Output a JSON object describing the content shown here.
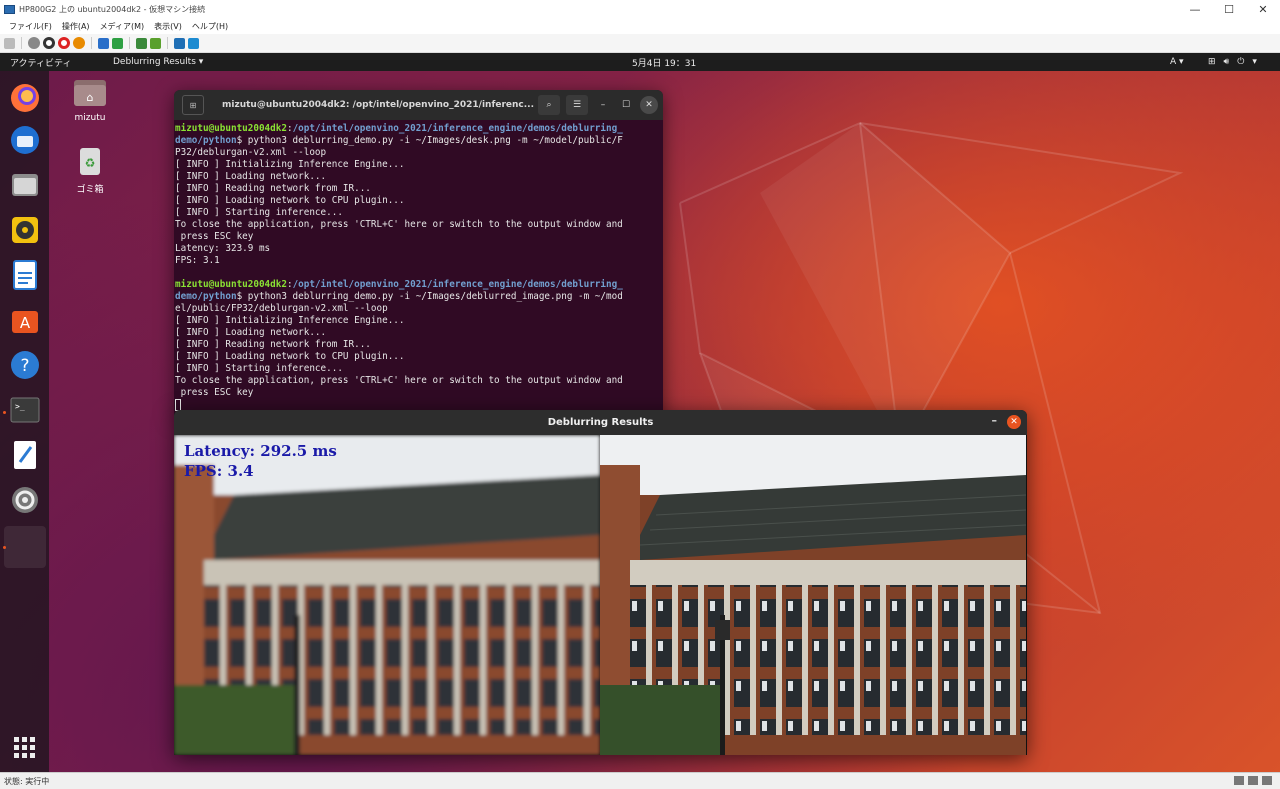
{
  "host": {
    "title": "HP800G2 上の ubuntu2004dk2 - 仮想マシン接続",
    "menu": [
      "ファイル(F)",
      "操作(A)",
      "メディア(M)",
      "表示(V)",
      "ヘルプ(H)"
    ],
    "status_text": "状態: 実行中"
  },
  "panel": {
    "activities": "アクティビティ",
    "app_menu": "Deblurring Results ▾",
    "clock": "5月4日  19：31",
    "input_method": "A ▾",
    "tray_menu": "▾"
  },
  "desktop": {
    "home_label": "mizutu",
    "trash_label": "ゴミ箱"
  },
  "terminal": {
    "title": "mizutu@ubuntu2004dk2: /opt/intel/openvino_2021/inferenc...",
    "user_host": "mizutu@ubuntu2004dk2",
    "path_1": "/opt/intel/openvino_2021/inference_engine/demos/deblurring_",
    "path_2": "demo/python",
    "cmd1_a": "$ python3 deblurring_demo.py -i ~/Images/desk.png -m ~/model/public/F",
    "cmd1_b": "P32/deblurgan-v2.xml --loop",
    "log1": [
      "[ INFO ] Initializing Inference Engine...",
      "[ INFO ] Loading network...",
      "[ INFO ] Reading network from IR...",
      "[ INFO ] Loading network to CPU plugin...",
      "[ INFO ] Starting inference...",
      "To close the application, press 'CTRL+C' here or switch to the output window and",
      " press ESC key",
      "Latency: 323.9 ms",
      "FPS: 3.1"
    ],
    "cmd2_a": "$ python3 deblurring_demo.py -i ~/Images/deblurred_image.png -m ~/mod",
    "cmd2_b": "el/public/FP32/deblurgan-v2.xml --loop",
    "log2": [
      "[ INFO ] Initializing Inference Engine...",
      "[ INFO ] Loading network...",
      "[ INFO ] Reading network from IR...",
      "[ INFO ] Loading network to CPU plugin...",
      "[ INFO ] Starting inference...",
      "To close the application, press 'CTRL+C' here or switch to the output window and",
      " press ESC key"
    ]
  },
  "results": {
    "title": "Deblurring Results",
    "latency": "Latency: 292.5 ms",
    "fps": "FPS: 3.4"
  }
}
